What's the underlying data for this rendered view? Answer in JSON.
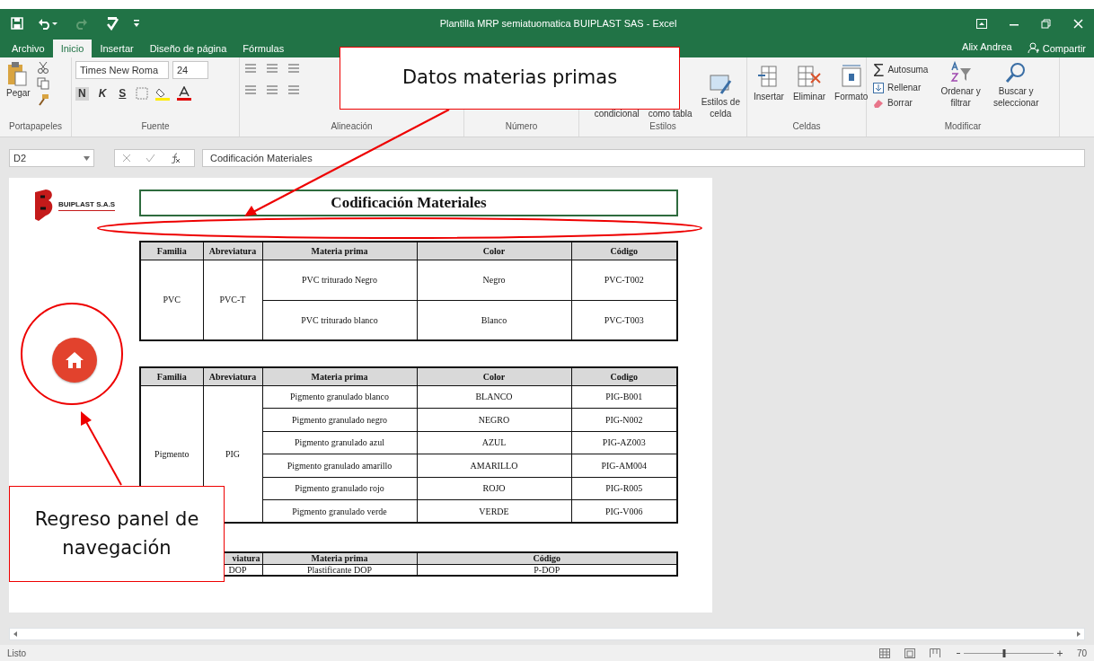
{
  "window": {
    "title": "Plantilla MRP semiatuomatica BUIPLAST SAS - Excel"
  },
  "tabs": [
    {
      "label": "Archivo",
      "selected": false
    },
    {
      "label": "Inicio",
      "selected": true
    },
    {
      "label": "Insertar",
      "selected": false
    },
    {
      "label": "Diseño de página",
      "selected": false
    },
    {
      "label": "Fórmulas",
      "selected": false
    }
  ],
  "account": {
    "user": "Alix Andrea",
    "share": "Compartir"
  },
  "ribbon": {
    "clipboard": {
      "paste": "Pegar",
      "group": "Portapapeles"
    },
    "font": {
      "name": "Times New Roma",
      "size": "24",
      "styles": [
        "N",
        "K",
        "S"
      ],
      "group": "Fuente"
    },
    "alignment": {
      "group": "Alineación"
    },
    "number": {
      "group": "Número"
    },
    "styles": {
      "buttons": [
        {
          "lines": [
            "condicional"
          ]
        },
        {
          "lines": [
            "como tabla"
          ]
        },
        {
          "lines": [
            "Estilos de",
            "celda"
          ]
        }
      ],
      "group": "Estilos"
    },
    "cells": {
      "buttons": [
        "Insertar",
        "Eliminar",
        "Formato"
      ],
      "group": "Celdas"
    },
    "editing": {
      "autosum_symbol": "Σ",
      "autosum": "Autosuma",
      "fill": "Rellenar",
      "clear": "Borrar",
      "sort": [
        "Ordenar y",
        "filtrar"
      ],
      "find": [
        "Buscar y",
        "seleccionar"
      ],
      "group": "Modificar"
    }
  },
  "formula_bar": {
    "name_box": "D2",
    "value": "Codificación Materiales"
  },
  "sheet": {
    "logo_text": "BUIPLAST S.A.S",
    "title": "Codificación Materiales",
    "tables": [
      {
        "kind": "full",
        "columns": [
          "Familia",
          "Abreviatura",
          "Materia prima",
          "Color",
          "Código"
        ],
        "family": "PVC",
        "abbreviation": "PVC-T",
        "rows": [
          {
            "material": "PVC triturado Negro",
            "color_name": "Negro",
            "code": "PVC-T002"
          },
          {
            "material": "PVC triturado blanco",
            "color_name": "Blanco",
            "code": "PVC-T003"
          }
        ]
      },
      {
        "kind": "full",
        "columns": [
          "Familia",
          "Abreviatura",
          "Materia prima",
          "Color",
          "Codigo"
        ],
        "family": "Pigmento",
        "abbreviation": "PIG",
        "rows": [
          {
            "material": "Pigmento granulado blanco",
            "color_name": "BLANCO",
            "code": "PIG-B001"
          },
          {
            "material": "Pigmento granulado negro",
            "color_name": "NEGRO",
            "code": "PIG-N002"
          },
          {
            "material": "Pigmento granulado azul",
            "color_name": "AZUL",
            "code": "PIG-AZ003"
          },
          {
            "material": "Pigmento granulado amarillo",
            "color_name": "AMARILLO",
            "code": "PIG-AM004"
          },
          {
            "material": "Pigmento granulado rojo",
            "color_name": "ROJO",
            "code": "PIG-R005"
          },
          {
            "material": "Pigmento granulado verde",
            "color_name": "VERDE",
            "code": "PIG-V006"
          }
        ]
      },
      {
        "kind": "compact",
        "columns": [
          "viatura",
          "Materia prima",
          "Código"
        ],
        "rows": [
          {
            "abbreviation": "DOP",
            "material": "Plastificante DOP",
            "code": "P-DOP"
          }
        ]
      }
    ]
  },
  "annotations": [
    {
      "text": "Datos materias primas"
    },
    {
      "text": "Regreso panel de navegación"
    }
  ],
  "status_bar": {
    "status": "Listo",
    "zoom_slider": {
      "level": 0.45
    },
    "zoom": "70"
  }
}
